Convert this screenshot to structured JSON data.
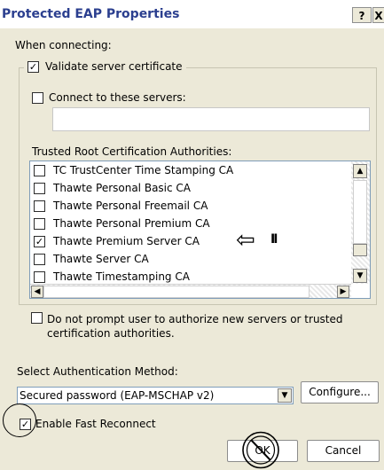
{
  "dialog": {
    "title": "Protected EAP Properties",
    "help_label": "?",
    "close_label": "X"
  },
  "connecting": {
    "heading": "When connecting:",
    "validate_label": "Validate server certificate",
    "validate_checked": true,
    "connect_servers_label": "Connect to these servers:",
    "connect_servers_checked": false,
    "servers_value": ""
  },
  "trusted": {
    "heading": "Trusted Root Certification Authorities:",
    "items": [
      {
        "label": "TC TrustCenter Time Stamping CA",
        "checked": false
      },
      {
        "label": "Thawte Personal Basic CA",
        "checked": false
      },
      {
        "label": "Thawte Personal Freemail CA",
        "checked": false
      },
      {
        "label": "Thawte Personal Premium CA",
        "checked": false
      },
      {
        "label": "Thawte Premium Server CA",
        "checked": true
      },
      {
        "label": "Thawte Server CA",
        "checked": false
      },
      {
        "label": "Thawte Timestamping CA",
        "checked": false
      }
    ],
    "annotation_arrow": "⇦",
    "annotation_bars": "II"
  },
  "no_prompt": {
    "label_line1": "Do not prompt user to authorize new servers or trusted",
    "label_line2": "certification authorities.",
    "checked": false
  },
  "auth": {
    "heading": "Select Authentication Method:",
    "selected": "Secured password (EAP-MSCHAP v2)",
    "configure_label": "Configure..."
  },
  "fast_reconnect": {
    "label": "Enable Fast Reconnect",
    "checked": true
  },
  "buttons": {
    "ok_label": "OK",
    "cancel_label": "Cancel"
  },
  "glyphs": {
    "check": "✓",
    "up": "▲",
    "down": "▼",
    "left": "◀",
    "right": "▶"
  }
}
